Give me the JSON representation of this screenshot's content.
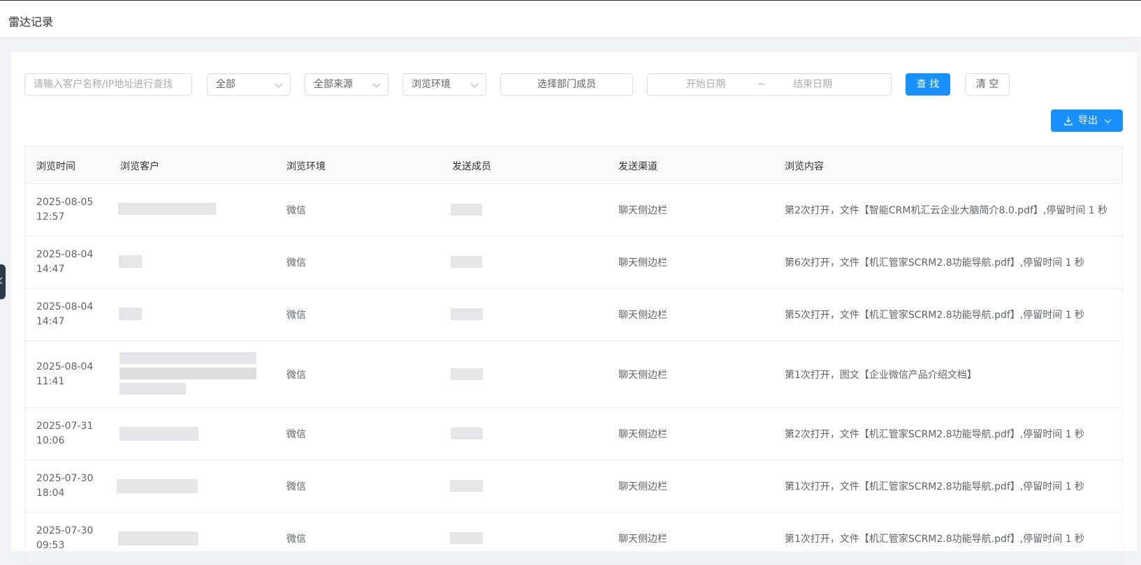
{
  "header": {
    "title": "雷达记录"
  },
  "filters": {
    "search_placeholder": "请输入客户名称/IP地址进行查找",
    "type_select": "全部",
    "source_select": "全部来源",
    "env_select": "浏览环境",
    "member_select": "选择部门成员",
    "start_date_placeholder": "开始日期",
    "date_separator": "~",
    "end_date_placeholder": "结束日期",
    "search_button": "查 找",
    "clear_button": "清 空",
    "export_button": "导出"
  },
  "table": {
    "columns": [
      "浏览时间",
      "浏览客户",
      "浏览环境",
      "发送成员",
      "发送渠道",
      "浏览内容"
    ],
    "rows": [
      {
        "date": "2025-08-05",
        "time": "12:57",
        "env": "微信",
        "channel": "聊天侧边栏",
        "content": "第2次打开，文件【智能CRM机汇云企业大脑简介8.0.pdf】,停留时间 1 秒"
      },
      {
        "date": "2025-08-04",
        "time": "14:47",
        "env": "微信",
        "channel": "聊天侧边栏",
        "content": "第6次打开，文件【机汇管家SCRM2.8功能导航.pdf】,停留时间 1 秒"
      },
      {
        "date": "2025-08-04",
        "time": "14:47",
        "env": "微信",
        "channel": "聊天侧边栏",
        "content": "第5次打开，文件【机汇管家SCRM2.8功能导航.pdf】,停留时间 1 秒"
      },
      {
        "date": "2025-08-04",
        "time": "11:41",
        "env": "微信",
        "channel": "聊天侧边栏",
        "content": "第1次打开，图文【企业微信产品介绍文档】"
      },
      {
        "date": "2025-07-31",
        "time": "10:06",
        "env": "微信",
        "channel": "聊天侧边栏",
        "content": "第2次打开，文件【机汇管家SCRM2.8功能导航.pdf】,停留时间 1 秒"
      },
      {
        "date": "2025-07-30",
        "time": "18:04",
        "env": "微信",
        "channel": "聊天侧边栏",
        "content": "第1次打开，文件【机汇管家SCRM2.8功能导航.pdf】,停留时间 1 秒"
      },
      {
        "date": "2025-07-30",
        "time": "09:53",
        "env": "微信",
        "channel": "聊天侧边栏",
        "content": "第1次打开，文件【机汇管家SCRM2.8功能导航.pdf】,停留时间 1 秒"
      }
    ]
  }
}
